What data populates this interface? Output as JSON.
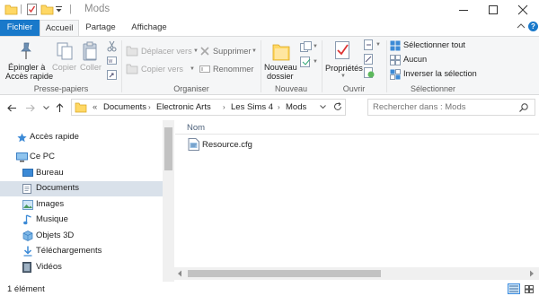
{
  "window": {
    "title": "Mods"
  },
  "ribbon_tabs": [
    {
      "label": "Fichier"
    },
    {
      "label": "Accueil"
    },
    {
      "label": "Partage"
    },
    {
      "label": "Affichage"
    }
  ],
  "ribbon": {
    "clipboard": {
      "pin_label_line1": "Épingler à",
      "pin_label_line2": "Accès rapide",
      "copy_label": "Copier",
      "paste_label": "Coller",
      "group_label": "Presse-papiers"
    },
    "organize": {
      "move_to_label": "Déplacer vers",
      "copy_to_label": "Copier vers",
      "delete_label": "Supprimer",
      "rename_label": "Renommer",
      "group_label": "Organiser"
    },
    "new": {
      "new_folder_line1": "Nouveau",
      "new_folder_line2": "dossier",
      "group_label": "Nouveau"
    },
    "open": {
      "properties_label": "Propriétés",
      "group_label": "Ouvrir"
    },
    "select": {
      "select_all_label": "Sélectionner tout",
      "select_none_label": "Aucun",
      "invert_label": "Inverser la sélection",
      "group_label": "Sélectionner"
    }
  },
  "address": {
    "overflow": "«",
    "crumbs": [
      "Documents",
      "Electronic Arts",
      "Les Sims 4",
      "Mods"
    ],
    "search_placeholder": "Rechercher dans : Mods"
  },
  "nav_pane": {
    "items": [
      {
        "label": "Accès rapide",
        "icon": "star-icon"
      },
      {
        "label": "Ce PC",
        "icon": "computer-icon"
      },
      {
        "label": "Bureau",
        "icon": "desktop-icon"
      },
      {
        "label": "Documents",
        "icon": "documents-icon",
        "selected": true
      },
      {
        "label": "Images",
        "icon": "images-icon"
      },
      {
        "label": "Musique",
        "icon": "music-icon"
      },
      {
        "label": "Objets 3D",
        "icon": "cube-icon"
      },
      {
        "label": "Téléchargements",
        "icon": "download-icon"
      },
      {
        "label": "Vidéos",
        "icon": "video-icon"
      }
    ]
  },
  "content": {
    "column_name": "Nom",
    "files": [
      {
        "name": "Resource.cfg",
        "icon": "cfg-file-icon"
      }
    ]
  },
  "status": {
    "count": "1 élément"
  },
  "colors": {
    "accent": "#1979ca",
    "selection": "#d9e1ea",
    "ribbon_bg": "#f5f6f7",
    "folder": "#ffd865"
  }
}
